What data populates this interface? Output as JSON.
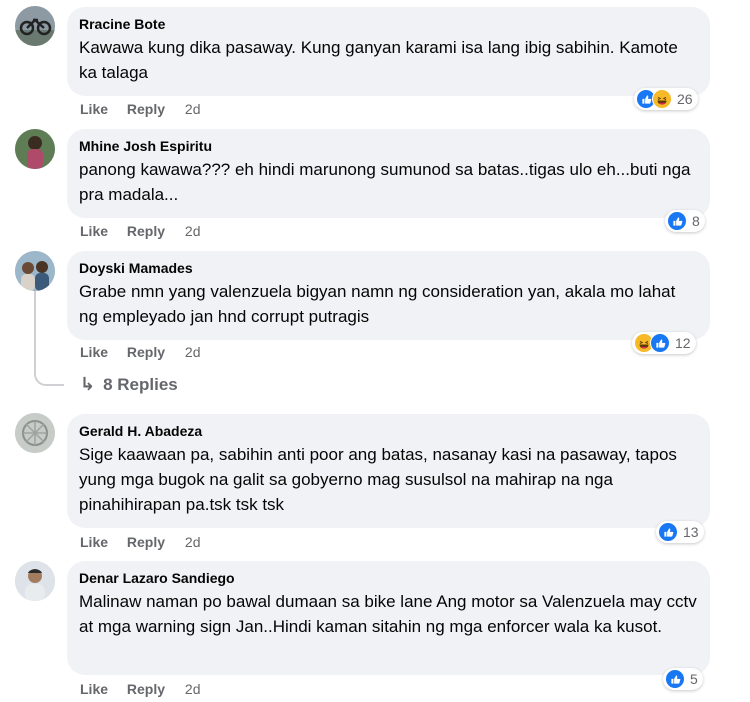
{
  "actions": {
    "like": "Like",
    "reply": "Reply"
  },
  "comments": [
    {
      "author": "Rracine Bote",
      "text": "Kawawa kung dika pasaway. Kung ganyan karami isa lang ibig sabihin. Kamote ka talaga",
      "time": "2d",
      "reaction_count": "26",
      "reactions": [
        "like-reaction-icon",
        "haha-reaction-icon"
      ]
    },
    {
      "author": "Mhine Josh Espiritu",
      "text": "panong kawawa??? eh hindi marunong sumunod sa batas..tigas ulo eh...buti nga pra madala...",
      "time": "2d",
      "reaction_count": "8",
      "reactions": [
        "like-reaction-icon"
      ]
    },
    {
      "author": "Doyski Mamades",
      "text": "Grabe nmn yang valenzuela bigyan namn ng consideration yan, akala mo lahat ng empleyado jan hnd corrupt putragis",
      "time": "2d",
      "reaction_count": "12",
      "reactions": [
        "haha-reaction-icon",
        "like-reaction-icon"
      ],
      "replies_label": "8 Replies"
    },
    {
      "author": "Gerald H. Abadeza",
      "text": "Sige kaawaan pa, sabihin anti poor ang batas, nasanay kasi na pasaway, tapos yung mga bugok na galit sa gobyerno mag susulsol na mahirap na nga pinahihirapan pa.tsk tsk tsk",
      "time": "2d",
      "reaction_count": "13",
      "reactions": [
        "like-reaction-icon"
      ]
    },
    {
      "author": "Denar Lazaro Sandiego",
      "text": "Malinaw naman po bawal dumaan sa bike lane Ang motor sa Valenzuela may cctv at mga warning sign Jan..Hindi kaman sitahin ng mga enforcer wala ka kusot.",
      "time": "2d",
      "reaction_count": "5",
      "reactions": [
        "like-reaction-icon"
      ]
    }
  ],
  "colors": {
    "bubble": "#f0f2f5",
    "secondary_text": "#65676b",
    "like_blue": "#1877f2",
    "haha_yellow": "#f7b928"
  }
}
